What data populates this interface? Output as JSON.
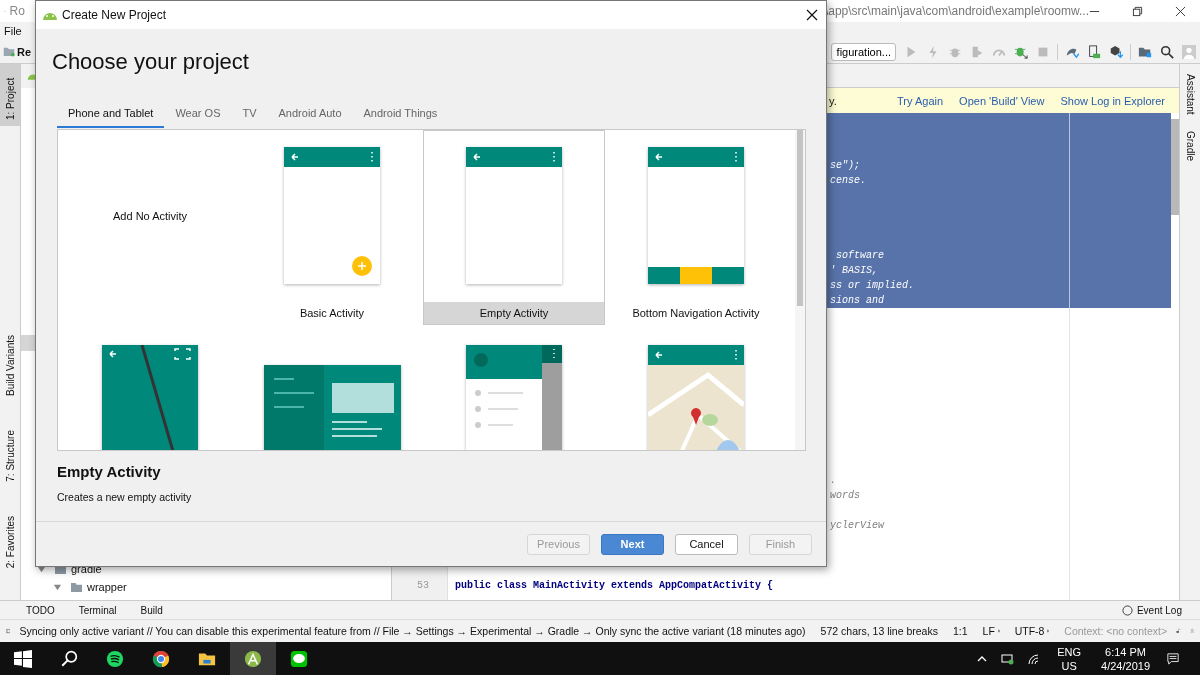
{
  "ide": {
    "title_fragment": "Ro",
    "path": "\\app\\src\\main\\java\\com\\android\\example\\roomw...",
    "menu": [
      "File"
    ],
    "project_crumb": "Re",
    "run_config": "figuration...",
    "left_tools": [
      {
        "label": "1: Project",
        "selected": true
      },
      {
        "label": "Build Variants",
        "selected": false
      },
      {
        "label": "7: Structure",
        "selected": false
      },
      {
        "label": "2: Favorites",
        "selected": false
      }
    ],
    "right_tools": [
      "Assistant",
      "Gradle"
    ],
    "banner": {
      "text": "y.",
      "actions": [
        "Try Again",
        "Open 'Build' View",
        "Show Log in Explorer"
      ]
    },
    "selected_code": [
      "se\");",
      "cense.",
      " software",
      "' BASIS,",
      "ss or implied.",
      "sions and"
    ],
    "code": [
      ".",
      "words",
      "yclerView"
    ],
    "code_row": {
      "number": "53",
      "text": "public class MainActivity extends AppCompatActivity {"
    },
    "tree": [
      {
        "name": "gradle",
        "expanded": true,
        "children": [
          {
            "name": "wrapper",
            "expanded": true
          }
        ]
      }
    ],
    "bottom_tools": [
      "TODO",
      "Terminal",
      "Build"
    ],
    "event_log": "Event Log",
    "status": {
      "message": "Syncing only active variant // You can disable this experimental feature from // File → Settings → Experimental → Gradle → Only sync the active variant (18 minutes ago)",
      "chars": "572 chars, 13 line breaks",
      "position": "1:1",
      "line_sep": "LF",
      "encoding": "UTF-8",
      "context": "Context: <no context>"
    }
  },
  "dialog": {
    "title": "Create New Project",
    "heading": "Choose your project",
    "tabs": [
      {
        "label": "Phone and Tablet",
        "selected": true
      },
      {
        "label": "Wear OS",
        "selected": false
      },
      {
        "label": "TV",
        "selected": false
      },
      {
        "label": "Android Auto",
        "selected": false
      },
      {
        "label": "Android Things",
        "selected": false
      }
    ],
    "templates": [
      {
        "kind": "none",
        "label": "Add No Activity",
        "selected": false
      },
      {
        "kind": "basic",
        "label": "Basic Activity",
        "selected": false
      },
      {
        "kind": "empty",
        "label": "Empty Activity",
        "selected": true
      },
      {
        "kind": "bottom_nav",
        "label": "Bottom Navigation Activity",
        "selected": false
      },
      {
        "kind": "fullscreen",
        "selected": false
      },
      {
        "kind": "master_detail",
        "selected": false
      },
      {
        "kind": "nav_drawer",
        "selected": false
      },
      {
        "kind": "maps",
        "selected": false
      }
    ],
    "detail_title": "Empty Activity",
    "detail_text": "Creates a new empty activity",
    "buttons": [
      {
        "label": "Previous",
        "disabled": true,
        "primary": false
      },
      {
        "label": "Next",
        "disabled": false,
        "primary": true
      },
      {
        "label": "Cancel",
        "disabled": false,
        "primary": false
      },
      {
        "label": "Finish",
        "disabled": true,
        "primary": false
      }
    ]
  },
  "taskbar": {
    "lang": "ENG",
    "region": "US",
    "time": "6:14 PM",
    "date": "4/24/2019"
  }
}
